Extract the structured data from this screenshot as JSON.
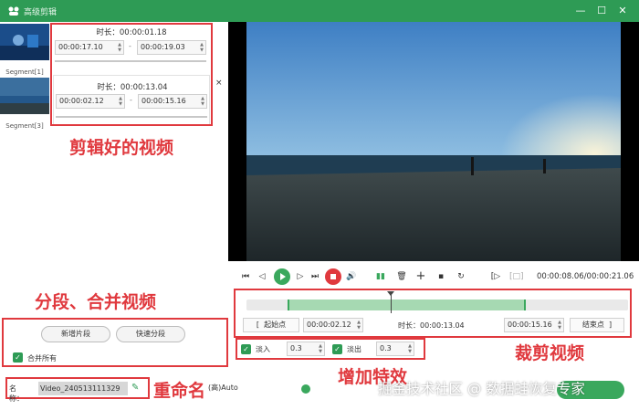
{
  "window": {
    "title": "高级剪辑"
  },
  "segments": [
    {
      "label": "Segment[1]",
      "duration": "时长：00:00:01.18",
      "start": "00:00:17.10",
      "end": "00:00:19.03"
    },
    {
      "label": "Segment[3]",
      "duration": "时长：00:00:13.04",
      "start": "00:00:02.12",
      "end": "00:00:15.16"
    }
  ],
  "segment_separator": "-",
  "close_glyph": "×",
  "annotations": {
    "clipped_videos": "剪辑好的视频",
    "split_merge": "分段、合并视频",
    "rename": "重命名",
    "trim_video": "裁剪视频",
    "add_effects": "增加特效"
  },
  "playback": {
    "time": "00:00:08.06/00:00:21.06"
  },
  "trim": {
    "start_btn": "起始点",
    "start_time": "00:00:02.12",
    "duration": "时长：00:00:13.04",
    "end_time": "00:00:15.16",
    "end_btn": "结束点",
    "left_bracket": "[",
    "right_bracket": "]"
  },
  "effects": {
    "fade_in_label": "淡入",
    "fade_in_value": "0.3",
    "fade_out_label": "淡出",
    "fade_out_value": "0.3"
  },
  "split": {
    "new_segment": "新增片段",
    "quick_split": "快速分段",
    "merge_all": "合并所有"
  },
  "output": {
    "name_label": "名称：",
    "name_value": "Video_240513111329",
    "format": "(高)Auto"
  },
  "watermark": "掘金技术社区 @ 数据蛙恢复专家",
  "colors": {
    "accent": "#2e9b55",
    "annotation": "#e0393e"
  }
}
